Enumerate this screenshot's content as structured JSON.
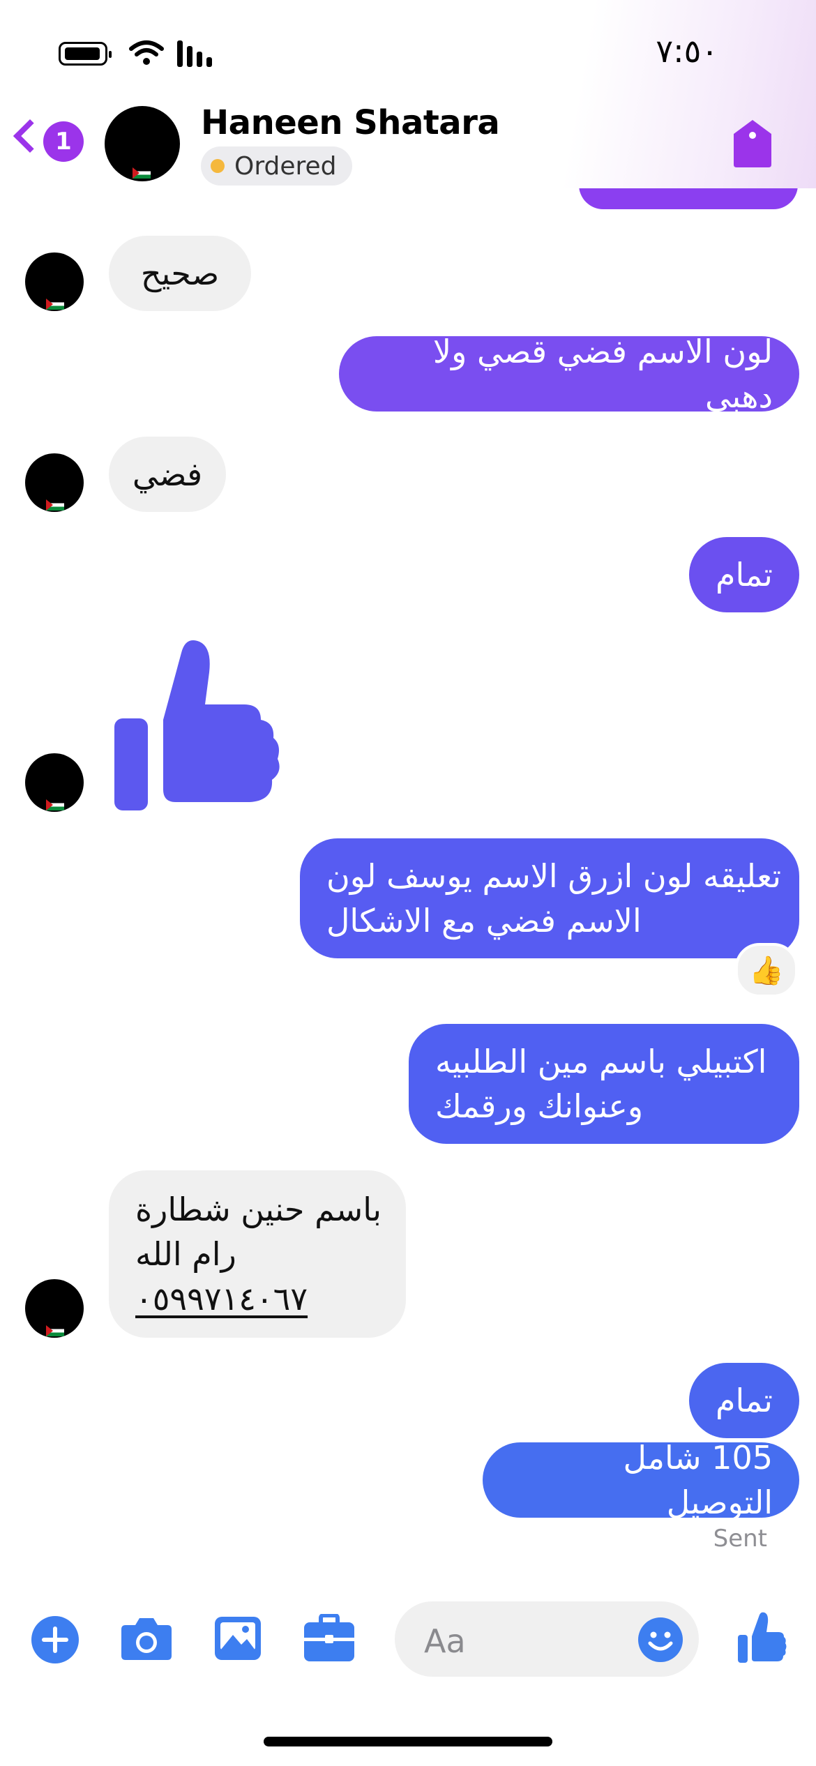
{
  "status_bar": {
    "time": "٧:٥٠"
  },
  "header": {
    "back_badge_count": "1",
    "contact_name": "Haneen Shatara",
    "status_label": "Ordered",
    "tag_icon": "tag-icon"
  },
  "messages": [
    {
      "from": "them",
      "text": "صحيح"
    },
    {
      "from": "me",
      "text": "لون الاسم فضي قصي ولا دهبي"
    },
    {
      "from": "them",
      "text": "فضي"
    },
    {
      "from": "me",
      "text": "تمام"
    },
    {
      "from": "them",
      "type": "sticker",
      "icon": "thumbs-up-icon"
    },
    {
      "from": "me",
      "lines": [
        "تعليقه لون ازرق الاسم يوسف لون",
        "الاسم فضي مع الاشكال"
      ],
      "reaction": "👍"
    },
    {
      "from": "me",
      "lines": [
        "اكتبيلي باسم مين الطلبيه",
        "وعنوانك ورقمك"
      ]
    },
    {
      "from": "them",
      "lines": [
        "باسم حنين شطارة",
        "رام الله",
        "٠٥٩٩٧١٤٠٦٧"
      ]
    },
    {
      "from": "me",
      "text": "تمام"
    },
    {
      "from": "me",
      "text": "105 شامل التوصيل"
    }
  ],
  "delivery_status": "Sent",
  "composer": {
    "placeholder": "Aa",
    "icons": [
      "plus-icon",
      "camera-icon",
      "gallery-icon",
      "briefcase-icon",
      "emoji-icon",
      "thumbs-up-icon"
    ]
  },
  "colors": {
    "accent_purple": "#9b34ea",
    "bubble_violet": "#7d4ff0",
    "bubble_indigo": "#5a5cf2",
    "bubble_blue": "#4a68f0",
    "composer_blue": "#3d7ef0",
    "incoming_bubble": "#f0f0f0"
  }
}
